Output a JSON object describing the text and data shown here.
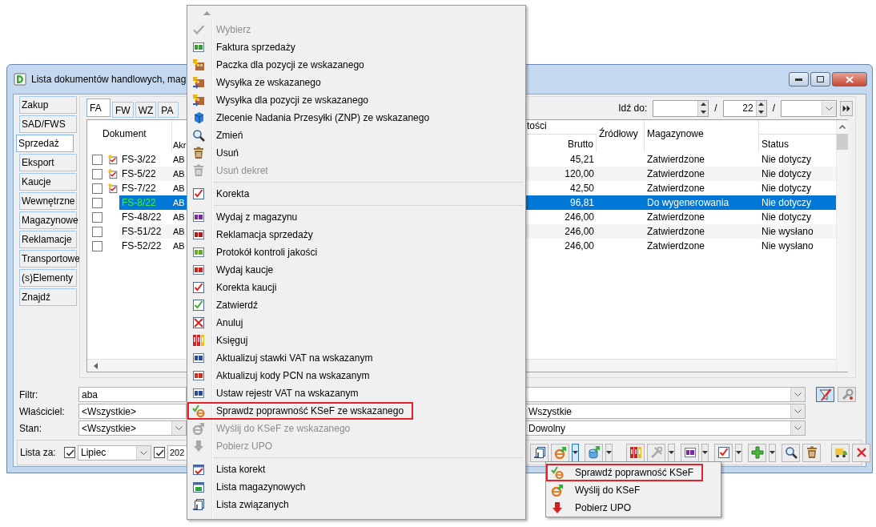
{
  "window": {
    "title": "Lista dokumentów handlowych, mag"
  },
  "sidebar": {
    "items": [
      {
        "label": "Zakup",
        "selected": false
      },
      {
        "label": "SAD/FWS",
        "selected": false
      },
      {
        "label": "Sprzedaż",
        "selected": true
      },
      {
        "label": "Eksport",
        "selected": false
      },
      {
        "label": "Kaucje",
        "selected": false
      },
      {
        "label": "Wewnętrzne",
        "selected": false
      },
      {
        "label": "Magazynowe",
        "selected": false
      },
      {
        "label": "Reklamacje",
        "selected": false
      },
      {
        "label": "Transportowe",
        "selected": false
      },
      {
        "label": "(s)Elementy",
        "selected": false
      },
      {
        "label": "Znajdź",
        "selected": false
      }
    ]
  },
  "tabs": [
    {
      "label": "FA",
      "selected": true
    },
    {
      "label": "FW",
      "selected": false
    },
    {
      "label": "WZ",
      "selected": false
    },
    {
      "label": "PA",
      "selected": false
    }
  ],
  "goto": {
    "label": "Idź do:",
    "page": "22",
    "separators": [
      "/",
      "/"
    ]
  },
  "table": {
    "columns": [
      {
        "label": "Dokument"
      },
      {
        "label": "Akr"
      },
      {
        "group": "tości",
        "label": "Brutto"
      },
      {
        "label": "Źródłowy"
      },
      {
        "label": "Magazynowe"
      },
      {
        "label": "Status"
      }
    ],
    "rows": [
      {
        "checked": false,
        "flagged": true,
        "selected": false,
        "document": "FS-3/22",
        "column_2": "AB",
        "gross": "45,21",
        "warehouse": "Zatwierdzone",
        "status": "Nie dotyczy"
      },
      {
        "checked": false,
        "flagged": true,
        "selected": false,
        "document": "FS-5/22",
        "column_2": "AB",
        "gross": "120,00",
        "warehouse": "Zatwierdzone",
        "status": "Nie dotyczy"
      },
      {
        "checked": false,
        "flagged": true,
        "selected": false,
        "document": "FS-7/22",
        "column_2": "AB",
        "gross": "42,50",
        "warehouse": "Zatwierdzone",
        "status": "Nie dotyczy"
      },
      {
        "checked": false,
        "flagged": false,
        "selected": true,
        "document": "FS-8/22",
        "column_2": "AB",
        "gross": "96,81",
        "warehouse": "Do wygenerowania",
        "status": "Nie dotyczy"
      },
      {
        "checked": false,
        "flagged": false,
        "selected": false,
        "document": "FS-48/22",
        "column_2": "AB",
        "gross": "246,00",
        "warehouse": "Zatwierdzone",
        "status": "Nie dotyczy"
      },
      {
        "checked": false,
        "flagged": false,
        "selected": false,
        "document": "FS-51/22",
        "column_2": "AB",
        "gross": "246,00",
        "warehouse": "Zatwierdzone",
        "status": "Nie wysłano"
      },
      {
        "checked": false,
        "flagged": false,
        "selected": false,
        "document": "FS-52/22",
        "column_2": "AB",
        "gross": "246,00",
        "warehouse": "Zatwierdzone",
        "status": "Nie wysłano"
      }
    ]
  },
  "filters": [
    {
      "label": "Filtr:",
      "value": "aba"
    },
    {
      "label": "Właściciel:",
      "value": "<Wszystkie>",
      "value_2": "Wszystkie"
    },
    {
      "label": "Stan:",
      "value": "<Wszystkie>",
      "value_2": "Dowolny"
    }
  ],
  "filter_buttons": [
    {
      "pressed": true
    },
    {
      "pressed": false
    }
  ],
  "period": {
    "label": "Lista za:",
    "month_enabled": true,
    "month": "Lipiec",
    "year_enabled": true,
    "year": "202"
  },
  "toolbar": [
    {
      "kind": "button"
    },
    {
      "kind": "split",
      "open": true
    },
    {
      "kind": "split",
      "open": false
    },
    {
      "kind": "button"
    },
    {
      "kind": "split",
      "disabled": true,
      "open": false
    },
    {
      "kind": "split",
      "open": false
    },
    {
      "kind": "split",
      "open": false
    },
    {
      "kind": "split",
      "open": false
    },
    {
      "kind": "button"
    },
    {
      "kind": "button"
    },
    {
      "kind": "button"
    },
    {
      "kind": "button"
    }
  ],
  "dropdown": {
    "items": [
      {
        "label": "Sprawdź poprawność KSeF",
        "outlined": true
      },
      {
        "label": "Wyślij do KSeF",
        "outlined": false
      },
      {
        "label": "Pobierz UPO",
        "outlined": false
      }
    ]
  },
  "context_menu": {
    "items": [
      {
        "kind": "item",
        "label": "Wybierz",
        "disabled": true,
        "outlined": false
      },
      {
        "kind": "item",
        "label": "Faktura sprzedaży",
        "disabled": false,
        "outlined": false
      },
      {
        "kind": "item",
        "label": "Paczka dla pozycji ze wskazanego",
        "disabled": false,
        "outlined": false
      },
      {
        "kind": "item",
        "label": "Wysyłka ze wskazanego",
        "disabled": false,
        "outlined": false
      },
      {
        "kind": "item",
        "label": "Wysyłka dla pozycji ze wskazanego",
        "disabled": false,
        "outlined": false
      },
      {
        "kind": "item",
        "label": "Zlecenie Nadania Przesyłki (ZNP) ze wskazanego",
        "disabled": false,
        "outlined": false
      },
      {
        "kind": "item",
        "label": "Zmień",
        "disabled": false,
        "outlined": false
      },
      {
        "kind": "item",
        "label": "Usuń",
        "disabled": false,
        "outlined": false
      },
      {
        "kind": "item",
        "label": "Usuń dekret",
        "disabled": true,
        "outlined": false
      },
      {
        "kind": "separator"
      },
      {
        "kind": "item",
        "label": "Korekta",
        "disabled": false,
        "outlined": false
      },
      {
        "kind": "separator"
      },
      {
        "kind": "item",
        "label": "Wydaj z magazynu",
        "disabled": false,
        "outlined": false
      },
      {
        "kind": "item",
        "label": "Reklamacja sprzedaży",
        "disabled": false,
        "outlined": false
      },
      {
        "kind": "item",
        "label": "Protokół kontroli jakości",
        "disabled": false,
        "outlined": false
      },
      {
        "kind": "item",
        "label": "Wydaj kaucje",
        "disabled": false,
        "outlined": false
      },
      {
        "kind": "item",
        "label": "Korekta kaucji",
        "disabled": false,
        "outlined": false
      },
      {
        "kind": "item",
        "label": "Zatwierdź",
        "disabled": false,
        "outlined": false
      },
      {
        "kind": "item",
        "label": "Anuluj",
        "disabled": false,
        "outlined": false
      },
      {
        "kind": "item",
        "label": "Księguj",
        "disabled": false,
        "outlined": false
      },
      {
        "kind": "item",
        "label": "Aktualizuj stawki VAT na wskazanym",
        "disabled": false,
        "outlined": false
      },
      {
        "kind": "item",
        "label": "Aktualizuj kody PCN na wskazanym",
        "disabled": false,
        "outlined": false
      },
      {
        "kind": "item",
        "label": "Ustaw rejestr VAT na wskazanym",
        "disabled": false,
        "outlined": false
      },
      {
        "kind": "item",
        "label": "Sprawdz poprawność KSeF ze wskazanego",
        "disabled": false,
        "outlined": true
      },
      {
        "kind": "item",
        "label": "Wyślij do KSeF ze wskazanego",
        "disabled": true,
        "outlined": false
      },
      {
        "kind": "item",
        "label": "Pobierz UPO",
        "disabled": true,
        "outlined": false
      },
      {
        "kind": "separator"
      },
      {
        "kind": "item",
        "label": "Lista korekt",
        "disabled": false,
        "outlined": false
      },
      {
        "kind": "item",
        "label": "Lista magazynowych",
        "disabled": false,
        "outlined": false
      },
      {
        "kind": "item",
        "label": "Lista związanych",
        "disabled": false,
        "outlined": false
      }
    ]
  }
}
